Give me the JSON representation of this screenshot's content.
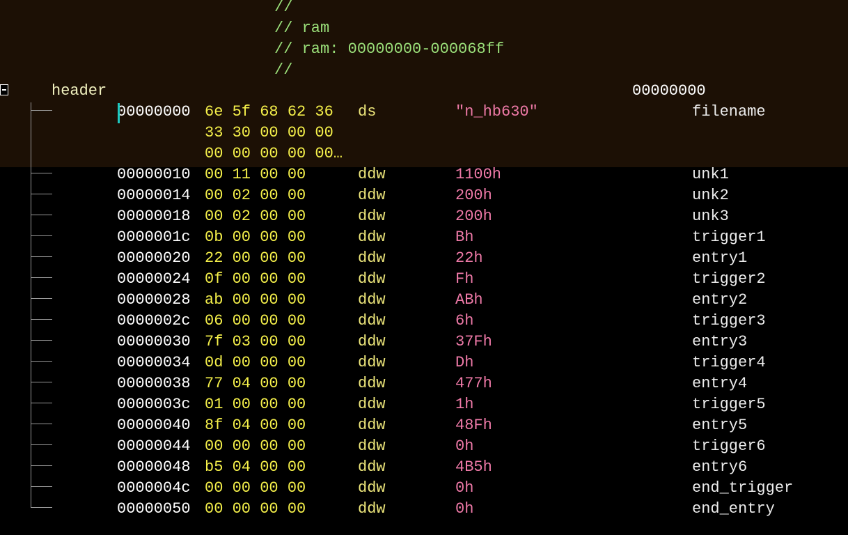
{
  "comments": [
    "//",
    "// ram",
    "// ram: 00000000-000068ff",
    "//"
  ],
  "structure": {
    "label": "header",
    "address": "00000000"
  },
  "first_item": {
    "address": "00000000",
    "bytes_lines": [
      "6e 5f 68 62 36",
      "33 30 00 00 00",
      "00 00 00 00 00…"
    ],
    "mnemonic": "ds",
    "value": "\"n_hb630\"",
    "name": "filename"
  },
  "rows": [
    {
      "address": "00000010",
      "bytes": "00 11 00 00",
      "mnemonic": "ddw",
      "value": "1100h",
      "name": "unk1"
    },
    {
      "address": "00000014",
      "bytes": "00 02 00 00",
      "mnemonic": "ddw",
      "value": "200h",
      "name": "unk2"
    },
    {
      "address": "00000018",
      "bytes": "00 02 00 00",
      "mnemonic": "ddw",
      "value": "200h",
      "name": "unk3"
    },
    {
      "address": "0000001c",
      "bytes": "0b 00 00 00",
      "mnemonic": "ddw",
      "value": "Bh",
      "name": "trigger1"
    },
    {
      "address": "00000020",
      "bytes": "22 00 00 00",
      "mnemonic": "ddw",
      "value": "22h",
      "name": "entry1"
    },
    {
      "address": "00000024",
      "bytes": "0f 00 00 00",
      "mnemonic": "ddw",
      "value": "Fh",
      "name": "trigger2"
    },
    {
      "address": "00000028",
      "bytes": "ab 00 00 00",
      "mnemonic": "ddw",
      "value": "ABh",
      "name": "entry2"
    },
    {
      "address": "0000002c",
      "bytes": "06 00 00 00",
      "mnemonic": "ddw",
      "value": "6h",
      "name": "trigger3"
    },
    {
      "address": "00000030",
      "bytes": "7f 03 00 00",
      "mnemonic": "ddw",
      "value": "37Fh",
      "name": "entry3"
    },
    {
      "address": "00000034",
      "bytes": "0d 00 00 00",
      "mnemonic": "ddw",
      "value": "Dh",
      "name": "trigger4"
    },
    {
      "address": "00000038",
      "bytes": "77 04 00 00",
      "mnemonic": "ddw",
      "value": "477h",
      "name": "entry4"
    },
    {
      "address": "0000003c",
      "bytes": "01 00 00 00",
      "mnemonic": "ddw",
      "value": "1h",
      "name": "trigger5"
    },
    {
      "address": "00000040",
      "bytes": "8f 04 00 00",
      "mnemonic": "ddw",
      "value": "48Fh",
      "name": "entry5"
    },
    {
      "address": "00000044",
      "bytes": "00 00 00 00",
      "mnemonic": "ddw",
      "value": "0h",
      "name": "trigger6"
    },
    {
      "address": "00000048",
      "bytes": "b5 04 00 00",
      "mnemonic": "ddw",
      "value": "4B5h",
      "name": "entry6"
    },
    {
      "address": "0000004c",
      "bytes": "00 00 00 00",
      "mnemonic": "ddw",
      "value": "0h",
      "name": "end_trigger"
    },
    {
      "address": "00000050",
      "bytes": "00 00 00 00",
      "mnemonic": "ddw",
      "value": "0h",
      "name": "end_entry"
    }
  ],
  "colors": {
    "background": "#000000",
    "highlight_band": "#1c1005",
    "comment": "#9be07a",
    "address": "#ffffff",
    "bytes": "#f5f04a",
    "mnemonic": "#ece57a",
    "value": "#ef7aa8",
    "name": "#ececec",
    "cursor": "#1ec8c0"
  }
}
